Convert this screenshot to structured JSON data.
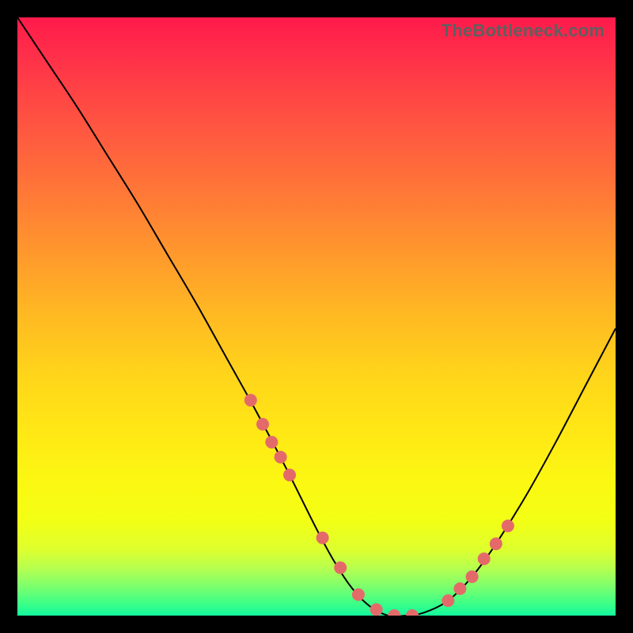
{
  "watermark": "TheBottleneck.com",
  "colors": {
    "marker": "#e46a6a",
    "curve": "#000000"
  },
  "chart_data": {
    "type": "line",
    "title": "",
    "xlabel": "",
    "ylabel": "",
    "xlim": [
      0,
      100
    ],
    "ylim": [
      0,
      100
    ],
    "grid": false,
    "legend": false,
    "series": [
      {
        "name": "bottleneck-curve",
        "x": [
          0,
          5,
          10,
          15,
          20,
          25,
          30,
          35,
          40,
          45,
          50,
          53,
          56,
          59,
          62,
          65,
          68,
          72,
          76,
          80,
          85,
          90,
          95,
          100
        ],
        "y": [
          100,
          92.5,
          85,
          77,
          69,
          60.5,
          52,
          43,
          34,
          24.5,
          14.5,
          9,
          4.5,
          1.5,
          0,
          0,
          0.5,
          2.5,
          6.5,
          12,
          20,
          29,
          38.5,
          48
        ]
      }
    ],
    "markers": {
      "name": "highlight-dots",
      "x": [
        39,
        41,
        42.5,
        44,
        45.5,
        51,
        54,
        57,
        60,
        63,
        66,
        72,
        74,
        76,
        78,
        80,
        82
      ],
      "y": [
        36,
        32,
        29,
        26.5,
        23.5,
        13,
        8,
        3.5,
        1,
        0,
        0,
        2.5,
        4.5,
        6.5,
        9.5,
        12,
        15
      ]
    }
  }
}
